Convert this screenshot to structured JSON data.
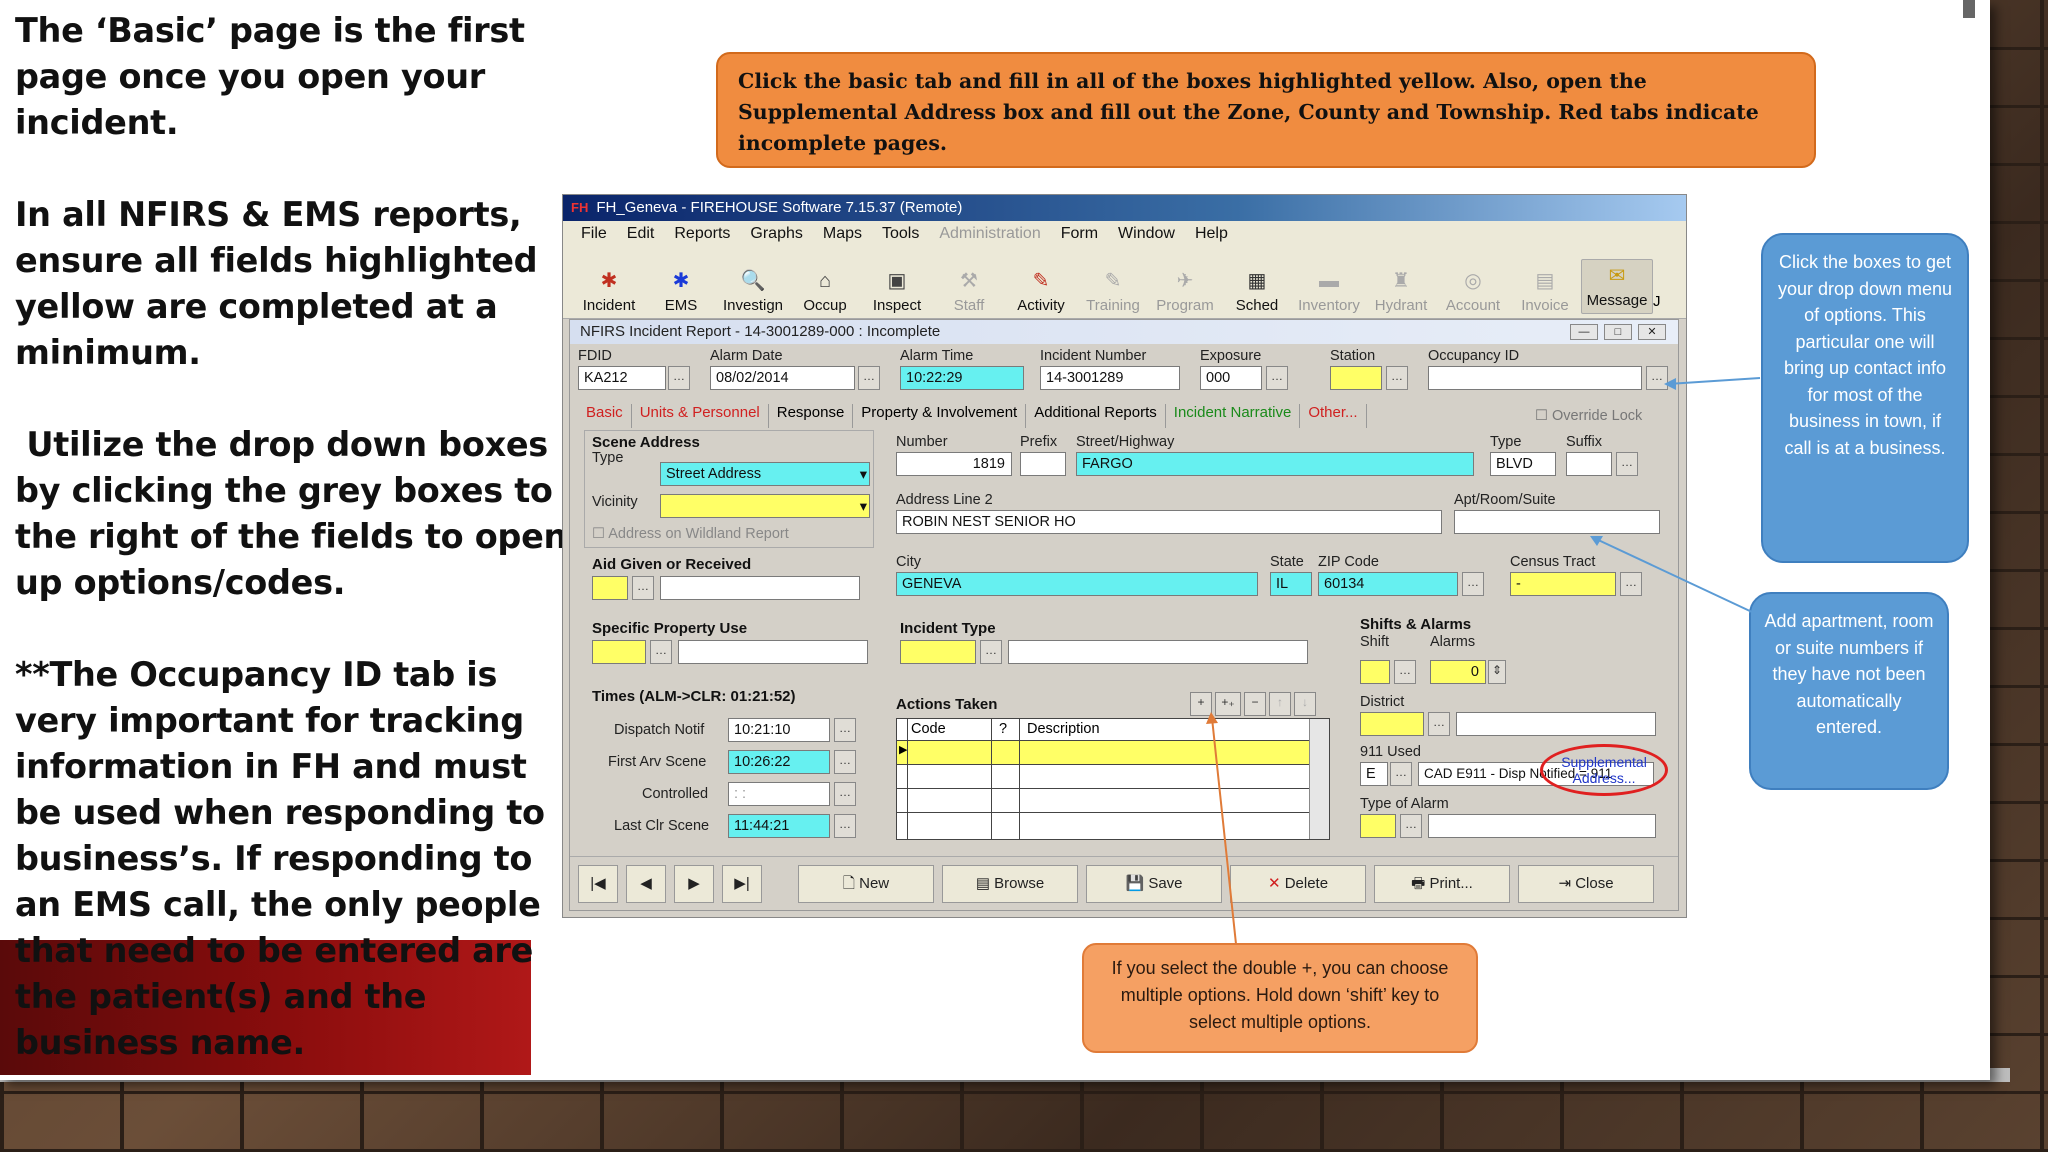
{
  "left_text": {
    "p1": "The ‘Basic’ page is the first page once you open your incident.",
    "p2": "In all NFIRS & EMS reports, ensure all fields highlighted yellow are completed at a minimum.",
    "p3": " Utilize the drop down boxes by clicking the grey boxes to the right of the fields to open up options/codes.",
    "p4": "**The Occupancy ID tab is very important for tracking information in FH and must be used when responding to business’s.  If responding to an EMS call, the only people that need to be entered are the patient(s) and the business name."
  },
  "callouts": {
    "top": "Click the basic tab and fill in all of the boxes highlighted yellow.  Also, open the Supplemental Address box and fill out the Zone, County and Township.  Red tabs indicate incomplete pages.",
    "right_top": "Click the boxes to get your drop down menu of options.  This particular one will bring up contact info for most of the business in town, if call is at a business.",
    "right_bottom": "Add apartment, room or suite numbers if they have not been automatically entered.",
    "bottom": "If you select the double +, you can choose multiple options.  Hold down ‘shift’ key to select multiple options."
  },
  "app": {
    "title_badge": "FH",
    "title": "FH_Geneva - FIREHOUSE Software 7.15.37 (Remote)",
    "menu": [
      {
        "label": "File",
        "disabled": false
      },
      {
        "label": "Edit",
        "disabled": false
      },
      {
        "label": "Reports",
        "disabled": false
      },
      {
        "label": "Graphs",
        "disabled": false
      },
      {
        "label": "Maps",
        "disabled": false
      },
      {
        "label": "Tools",
        "disabled": false
      },
      {
        "label": "Administration",
        "disabled": true
      },
      {
        "label": "Form",
        "disabled": false
      },
      {
        "label": "Window",
        "disabled": false
      },
      {
        "label": "Help",
        "disabled": false
      }
    ],
    "toolbar": [
      {
        "label": "Incident",
        "icon": "incident-icon",
        "glyph": "✱",
        "color": "#c03020",
        "disabled": false
      },
      {
        "label": "EMS",
        "icon": "ems-star-icon",
        "glyph": "✱",
        "color": "#1a3ad8",
        "disabled": false
      },
      {
        "label": "Investign",
        "icon": "investigation-icon",
        "glyph": "🔍",
        "color": "#4a7a2a",
        "disabled": false
      },
      {
        "label": "Occup",
        "icon": "occupancy-icon",
        "glyph": "⌂",
        "color": "#444",
        "disabled": false
      },
      {
        "label": "Inspect",
        "icon": "inspect-icon",
        "glyph": "▣",
        "color": "#444",
        "disabled": false
      },
      {
        "label": "Staff",
        "icon": "staff-icon",
        "glyph": "⚒",
        "color": "#aaa",
        "disabled": true
      },
      {
        "label": "Activity",
        "icon": "activity-icon",
        "glyph": "✎",
        "color": "#c03020",
        "disabled": false
      },
      {
        "label": "Training",
        "icon": "training-icon",
        "glyph": "✎",
        "color": "#aaa",
        "disabled": true
      },
      {
        "label": "Program",
        "icon": "program-icon",
        "glyph": "✈",
        "color": "#aaa",
        "disabled": true
      },
      {
        "label": "Sched",
        "icon": "schedule-icon",
        "glyph": "▦",
        "color": "#333",
        "disabled": false
      },
      {
        "label": "Inventory",
        "icon": "inventory-icon",
        "glyph": "▬",
        "color": "#aaa",
        "disabled": true
      },
      {
        "label": "Hydrant",
        "icon": "hydrant-icon",
        "glyph": "♜",
        "color": "#aaa",
        "disabled": true
      },
      {
        "label": "Account",
        "icon": "account-icon",
        "glyph": "◎",
        "color": "#aaa",
        "disabled": true
      },
      {
        "label": "Invoice",
        "icon": "invoice-icon",
        "glyph": "▤",
        "color": "#aaa",
        "disabled": true
      },
      {
        "label": "Message",
        "icon": "message-icon",
        "glyph": "✉",
        "color": "#c89a10",
        "disabled": false
      }
    ],
    "toolbar_overflow": "J",
    "report_title": "NFIRS Incident Report  - 14-3001289-000   : Incomplete",
    "tabs": [
      {
        "label": "Basic",
        "state": "red"
      },
      {
        "label": "Units & Personnel",
        "state": "red"
      },
      {
        "label": "Response",
        "state": "normal"
      },
      {
        "label": "Property & Involvement",
        "state": "normal"
      },
      {
        "label": "Additional Reports",
        "state": "normal"
      },
      {
        "label": "Incident Narrative",
        "state": "green"
      },
      {
        "label": "Other...",
        "state": "red"
      }
    ],
    "override_lock": "Override Lock",
    "header_fields": {
      "fdid_label": "FDID",
      "fdid": "KA212",
      "alarm_date_label": "Alarm Date",
      "alarm_date": "08/02/2014",
      "alarm_time_label": "Alarm Time",
      "alarm_time": "10:22:29",
      "incident_number_label": "Incident Number",
      "incident_number": "14-3001289",
      "exposure_label": "Exposure",
      "exposure": "000",
      "station_label": "Station",
      "station": "",
      "occupancy_label": "Occupancy ID",
      "occupancy": ""
    },
    "scene": {
      "heading": "Scene Address",
      "type_label": "Type",
      "type_value": "Street Address",
      "vicinity_label": "Vicinity",
      "vicinity_value": "",
      "wildland": "Address on Wildland Report",
      "number_label": "Number",
      "number": "1819",
      "prefix_label": "Prefix",
      "prefix": "",
      "street_label": "Street/Highway",
      "street": "FARGO",
      "stype_label": "Type",
      "stype": "BLVD",
      "suffix_label": "Suffix",
      "suffix": "",
      "addr2_label": "Address Line 2",
      "addr2": "ROBIN NEST SENIOR HO",
      "apt_label": "Apt/Room/Suite",
      "apt": "",
      "city_label": "City",
      "city": "GENEVA",
      "state_label": "State",
      "state": "IL",
      "zip_label": "ZIP Code",
      "zip": "60134",
      "census_label": "Census Tract",
      "census": "  -",
      "supplemental": "Supplemental Address..."
    },
    "aid_heading": "Aid Given or Received",
    "spu_heading": "Specific Property Use",
    "incident_type_heading": "Incident Type",
    "shifts": {
      "heading": "Shifts & Alarms",
      "shift_label": "Shift",
      "alarms_label": "Alarms",
      "alarms": "0",
      "district_label": "District",
      "used911_label": "911 Used",
      "used911_code": "E",
      "used911_desc": "CAD E911 - Disp Notified = 911",
      "type_alarm_label": "Type of Alarm"
    },
    "times": {
      "heading": "Times (ALM->CLR: 01:21:52)",
      "dispatch_label": "Dispatch Notif",
      "dispatch": "10:21:10",
      "arrive_label": "First Arv Scene",
      "arrive": "10:26:22",
      "controlled_label": "Controlled",
      "controlled": " : :",
      "lastclr_label": "Last Clr Scene",
      "lastclr": "11:44:21"
    },
    "actions": {
      "heading": "Actions Taken",
      "col_code": "Code",
      "col_q": "?",
      "col_desc": "Description",
      "ctl_add": "+",
      "ctl_addmulti": "+₊",
      "ctl_remove": "−",
      "ctl_up": "↑",
      "ctl_down": "↓"
    },
    "buttons": {
      "new": "New",
      "browse": "Browse",
      "save": "Save",
      "delete": "Delete",
      "print": "Print...",
      "close": "Close"
    }
  },
  "colors": {
    "yellow_field": "#ffff66",
    "cyan_field": "#66f0f0",
    "orange_callout": "#f08c40",
    "blue_callout": "#5b9bd5"
  }
}
